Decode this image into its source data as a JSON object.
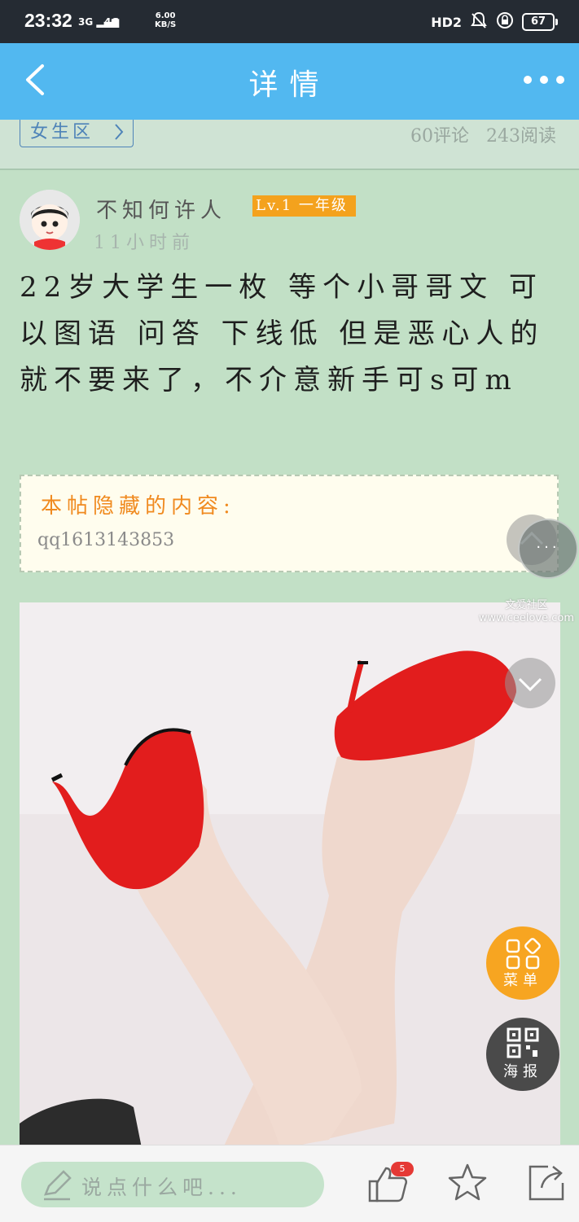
{
  "status_bar": {
    "time": "23:32",
    "signal_1": "3G",
    "signal_2": "4G",
    "net_speed_value": "6.00",
    "net_speed_unit": "KB/S",
    "hd_label": "HD2",
    "battery": "67"
  },
  "header": {
    "title": "详情",
    "back_icon": "chevron-left-icon",
    "more_icon": "more-dots-icon"
  },
  "section": {
    "tag": "女生区",
    "comments": "60评论",
    "reads": "243阅读"
  },
  "post": {
    "author": "不知何许人",
    "level": "Lv.1 一年级",
    "time_ago": "11小时前",
    "content": "22岁大学生一枚 等个小哥哥文 可以图语 问答 下线低 但是恶心人的就不要来了，不介意新手可s可m",
    "hidden_title": "本帖隐藏的内容:",
    "hidden_value": "qq1613143853"
  },
  "watermark": {
    "line1": "文爱社区",
    "line2": "www.ceelove.com"
  },
  "floating": {
    "menu_label": "菜单",
    "poster_label": "海报",
    "more_dots": "···"
  },
  "bottom_bar": {
    "comment_placeholder": "说点什么吧...",
    "like_count": "5",
    "colors": {
      "accent": "#52b8f0",
      "orange": "#f7a521",
      "badge": "#e53935"
    }
  }
}
